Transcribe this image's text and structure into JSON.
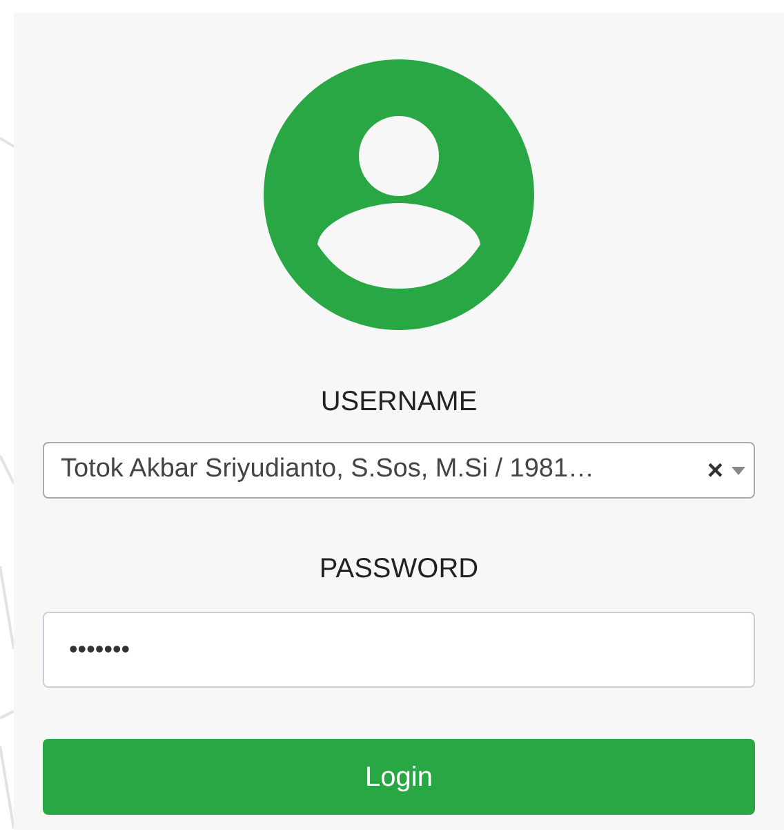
{
  "username": {
    "label": "USERNAME",
    "value": "Totok Akbar Sriyudianto, S.Sos, M.Si / 1981…",
    "clear": "×"
  },
  "password": {
    "label": "PASSWORD",
    "value": "•••••••"
  },
  "login_button": {
    "label": "Login"
  }
}
